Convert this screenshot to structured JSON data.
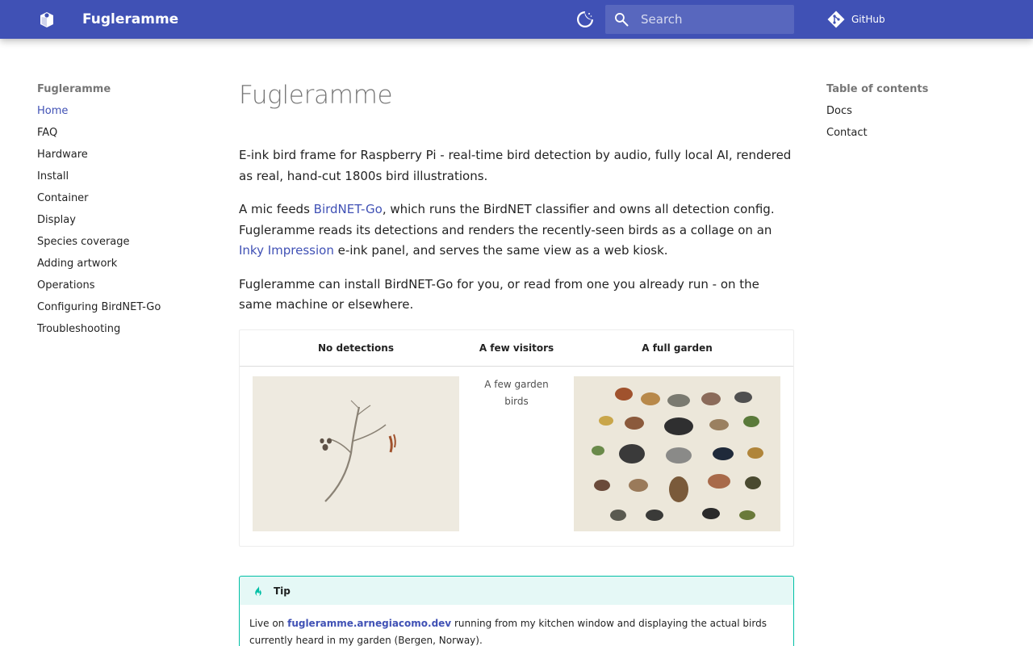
{
  "header": {
    "site_title": "Fugleramme",
    "search_placeholder": "Search",
    "repo_label": "GitHub",
    "colors": {
      "primary": "#4051b5",
      "tip_accent": "#00bfa5"
    },
    "icons": [
      "logo-icon",
      "theme-toggle-icon",
      "search-icon",
      "git-icon"
    ]
  },
  "nav": {
    "title": "Fugleramme",
    "items": [
      {
        "label": "Home",
        "active": true
      },
      {
        "label": "FAQ"
      },
      {
        "label": "Hardware"
      },
      {
        "label": "Install"
      },
      {
        "label": "Container"
      },
      {
        "label": "Display"
      },
      {
        "label": "Species coverage"
      },
      {
        "label": "Adding artwork"
      },
      {
        "label": "Operations"
      },
      {
        "label": "Configuring BirdNET-Go"
      },
      {
        "label": "Troubleshooting"
      }
    ]
  },
  "toc": {
    "title": "Table of contents",
    "items": [
      {
        "label": "Docs"
      },
      {
        "label": "Contact"
      }
    ]
  },
  "content": {
    "title": "Fugleramme",
    "p1": "E-ink bird frame for Raspberry Pi - real-time bird detection by audio, fully local AI, rendered as real, hand-cut 1800s bird illustrations.",
    "p2": {
      "before": "A mic feeds ",
      "link1": "BirdNET-Go",
      "middle": ", which runs the BirdNET classifier and owns all detection config. Fugleramme reads its detections and renders the recently-seen birds as a collage on an ",
      "link2": "Inky Impression",
      "after": " e-ink panel, and serves the same view as a web kiosk."
    },
    "p3": "Fugleramme can install BirdNET-Go for you, or read from one you already run - on the same machine or elsewhere.",
    "table": {
      "headers": [
        "No detections",
        "A few visitors",
        "A full garden"
      ],
      "broken_alt": "A few garden birds"
    },
    "tip": {
      "title": "Tip",
      "before": "Live on ",
      "link": "fugleramme.arnegiacomo.dev",
      "after": " running from my kitchen window and displaying the actual birds currently heard in my garden (Bergen, Norway)."
    }
  }
}
